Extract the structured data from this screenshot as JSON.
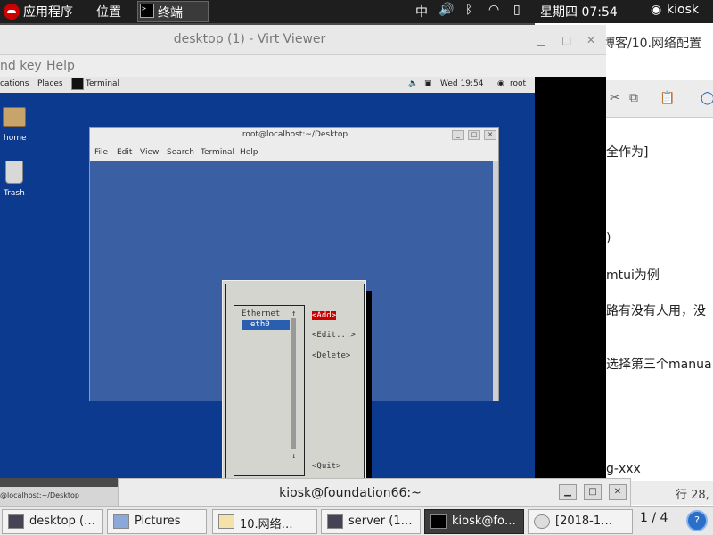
{
  "host_topbar": {
    "apps": "应用程序",
    "places": "位置",
    "terminal_task": "终端",
    "input_method": "中",
    "datetime": "星期四 07:54",
    "user": "kiosk"
  },
  "bg_doc": {
    "title": "博客/10.网络配置",
    "lines": [
      "全作为]",
      ")",
      "mtui为例",
      "路有没有人用，没",
      "选择第三个manua",
      "g-xxx"
    ],
    "status": "行 28,"
  },
  "virt_viewer": {
    "title": "desktop (1) - Virt Viewer",
    "menu_send_key": "nd key",
    "menu_help": "Help",
    "status_strip": "@localhost:~/Desktop"
  },
  "guest": {
    "panel": {
      "applications": "cations",
      "places": "Places",
      "terminal": "Terminal",
      "clock": "Wed 19:54",
      "user": "root"
    },
    "icons": {
      "home": "home",
      "trash": "Trash"
    },
    "terminal": {
      "title": "root@localhost:~/Desktop",
      "menu": [
        "File",
        "Edit",
        "View",
        "Search",
        "Terminal",
        "Help"
      ]
    },
    "nmtui": {
      "list_header": "Ethernet",
      "list_item": "eth0",
      "scroll_up": "↑",
      "scroll_down": "↓",
      "add": "<Add>",
      "edit": "<Edit...>",
      "delete": "<Delete>",
      "quit": "<Quit>"
    }
  },
  "kiosk_terminal": {
    "title": "kiosk@foundation66:~"
  },
  "taskbar": {
    "tasks": [
      "desktop (…",
      "Pictures",
      "10.网络…",
      "server (1…",
      "kiosk@fo…",
      "[2018-1…"
    ],
    "pager": "1 / 4"
  }
}
